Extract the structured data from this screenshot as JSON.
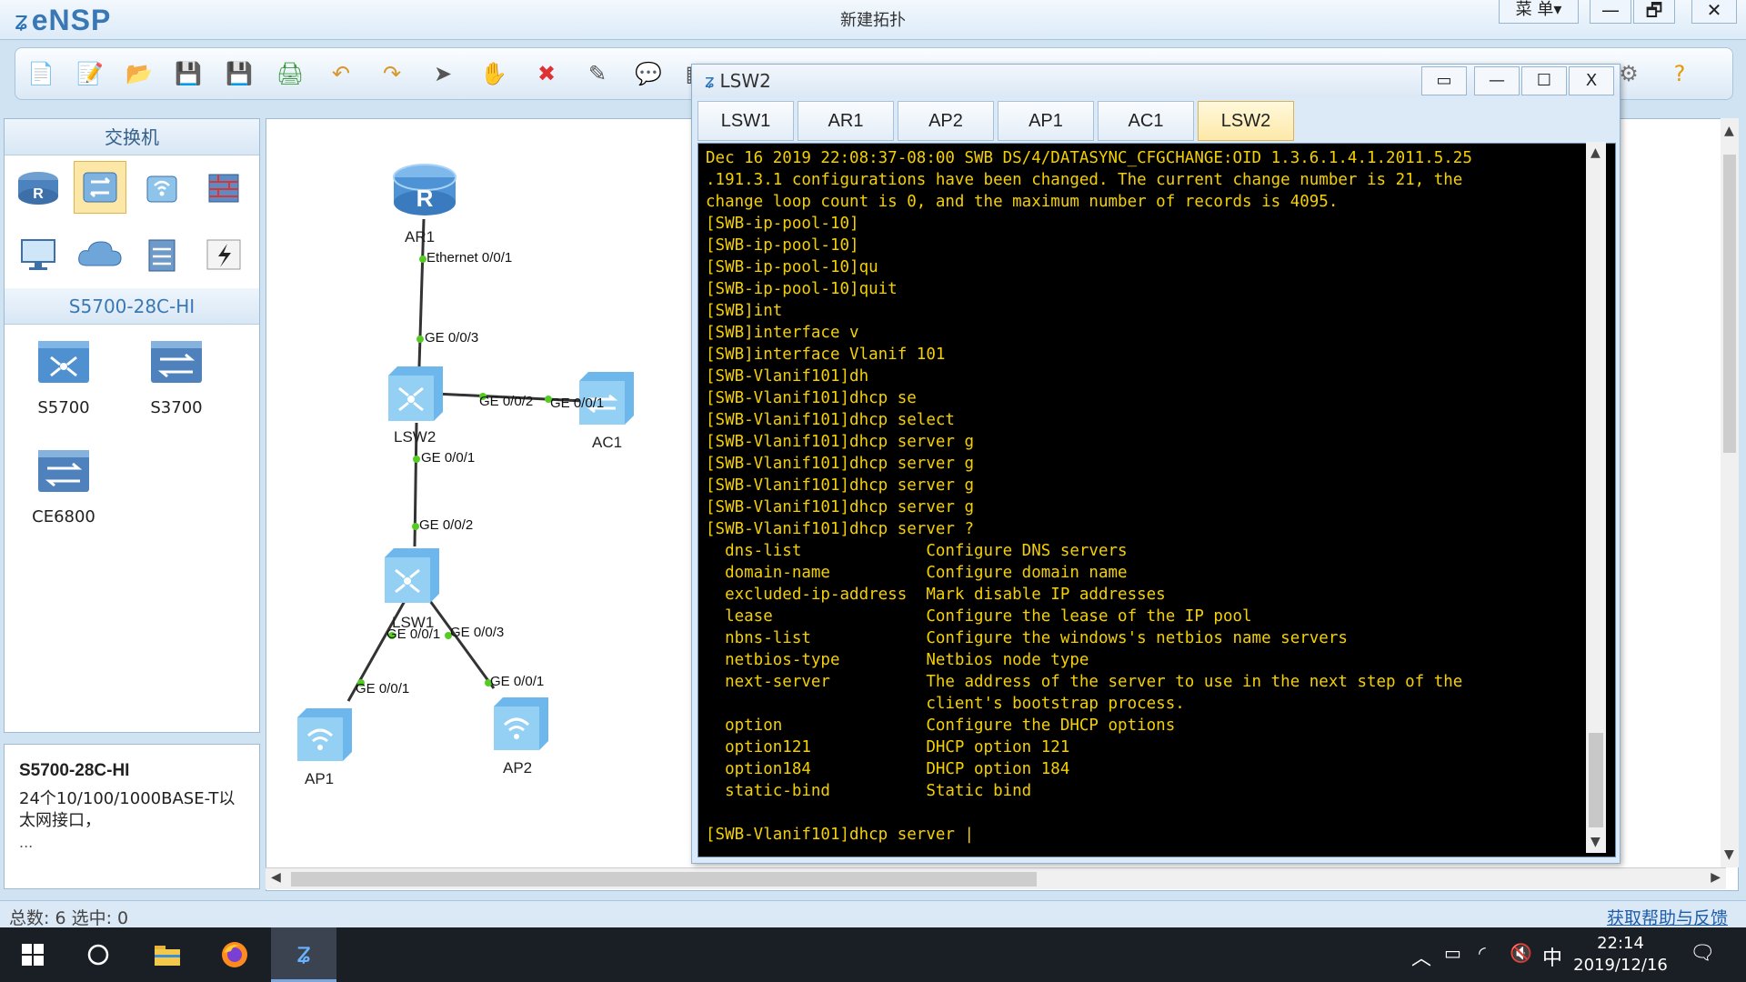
{
  "window": {
    "app_name": "eNSP",
    "title": "新建拓扑",
    "menu_label": "菜 单▾",
    "minimize": "—",
    "restore": "🗗",
    "close": "✕"
  },
  "left_panel": {
    "category_header": "交换机",
    "model_header": "S5700-28C-HI",
    "devices": [
      {
        "label": "S5700"
      },
      {
        "label": "S3700"
      },
      {
        "label": "CE6800"
      }
    ]
  },
  "info_panel": {
    "title": "S5700-28C-HI",
    "description": "24个10/100/1000BASE-T以太网接口，",
    "more": "..."
  },
  "topology": {
    "nodes": [
      {
        "label": "AR1"
      },
      {
        "label": "LSW2"
      },
      {
        "label": "AC1"
      },
      {
        "label": "LSW1"
      },
      {
        "label": "AP1"
      },
      {
        "label": "AP2"
      }
    ],
    "ports": [
      "Ethernet 0/0/1",
      "GE 0/0/3",
      "GE 0/0/2",
      "GE 0/0/1",
      "GE 0/0/1",
      "GE 0/0/2",
      "GE 0/0/1",
      "GE 0/0/3",
      "GE 0/0/1",
      "GE 0/0/1"
    ]
  },
  "console": {
    "title": "LSW2",
    "tabs": [
      "LSW1",
      "AR1",
      "AP2",
      "AP1",
      "AC1",
      "LSW2"
    ],
    "active_tab": "LSW2",
    "text": "Dec 16 2019 22:08:37-08:00 SWB DS/4/DATASYNC_CFGCHANGE:OID 1.3.6.1.4.1.2011.5.25\n.191.3.1 configurations have been changed. The current change number is 21, the\nchange loop count is 0, and the maximum number of records is 4095.\n[SWB-ip-pool-10]\n[SWB-ip-pool-10]\n[SWB-ip-pool-10]qu\n[SWB-ip-pool-10]quit\n[SWB]int\n[SWB]interface v\n[SWB]interface Vlanif 101\n[SWB-Vlanif101]dh\n[SWB-Vlanif101]dhcp se\n[SWB-Vlanif101]dhcp select\n[SWB-Vlanif101]dhcp server g\n[SWB-Vlanif101]dhcp server g\n[SWB-Vlanif101]dhcp server g\n[SWB-Vlanif101]dhcp server g\n[SWB-Vlanif101]dhcp server ?\n  dns-list             Configure DNS servers\n  domain-name          Configure domain name\n  excluded-ip-address  Mark disable IP addresses\n  lease                Configure the lease of the IP pool\n  nbns-list            Configure the windows's netbios name servers\n  netbios-type         Netbios node type\n  next-server          The address of the server to use in the next step of the\n                       client's bootstrap process.\n  option               Configure the DHCP options\n  option121            DHCP option 121\n  option184            DHCP option 184\n  static-bind          Static bind",
    "prompt": "[SWB-Vlanif101]dhcp server |"
  },
  "statusbar": {
    "count": "总数: 6  选中: 0",
    "help": "获取帮助与反馈"
  },
  "taskbar": {
    "time": "22:14",
    "date": "2019/12/16",
    "ime": "中"
  },
  "colors": {
    "terminal_text": "#f5d000",
    "terminal_bg": "#000000",
    "link_line": "#333333",
    "port_dot": "#55cc22"
  }
}
